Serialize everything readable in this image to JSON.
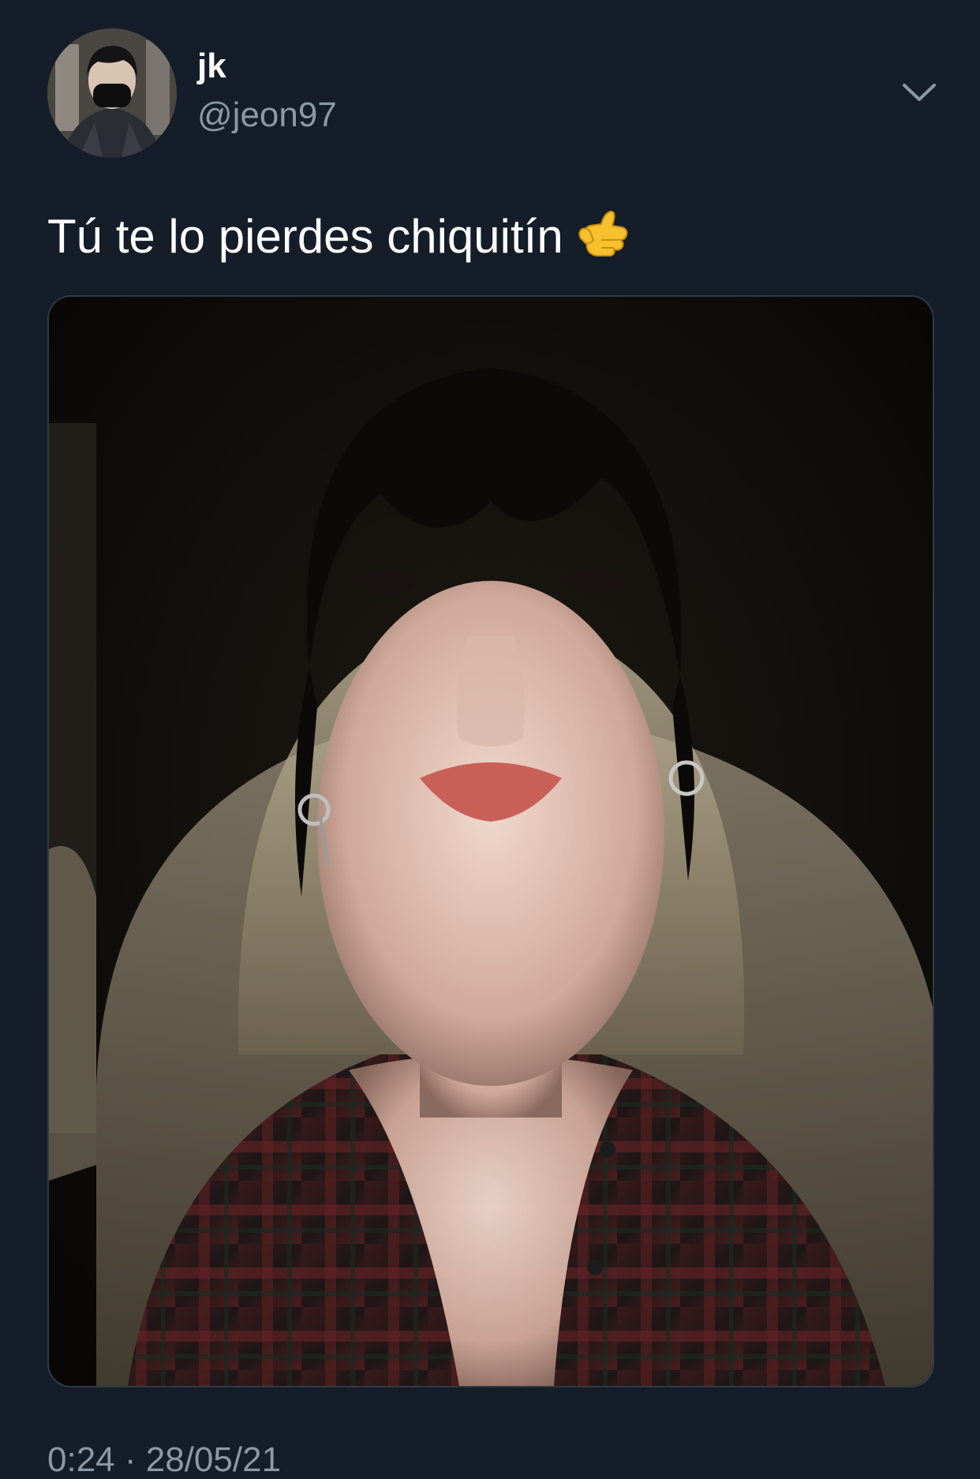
{
  "tweet": {
    "author": {
      "display_name": "jk",
      "handle": "@jeon97",
      "avatar_icon": "profile-photo"
    },
    "text": "Tú te lo pierdes chiquitín",
    "emoji": "call-me-hand-emoji",
    "media": {
      "type": "photo"
    },
    "time": "0:24",
    "separator": "·",
    "date": "28/05/21",
    "more_icon": "chevron-down-icon"
  },
  "colors": {
    "background": "#151d29",
    "primary_text": "#ffffff",
    "secondary_text": "#8b98a5",
    "media_border": "#2f3a47"
  }
}
